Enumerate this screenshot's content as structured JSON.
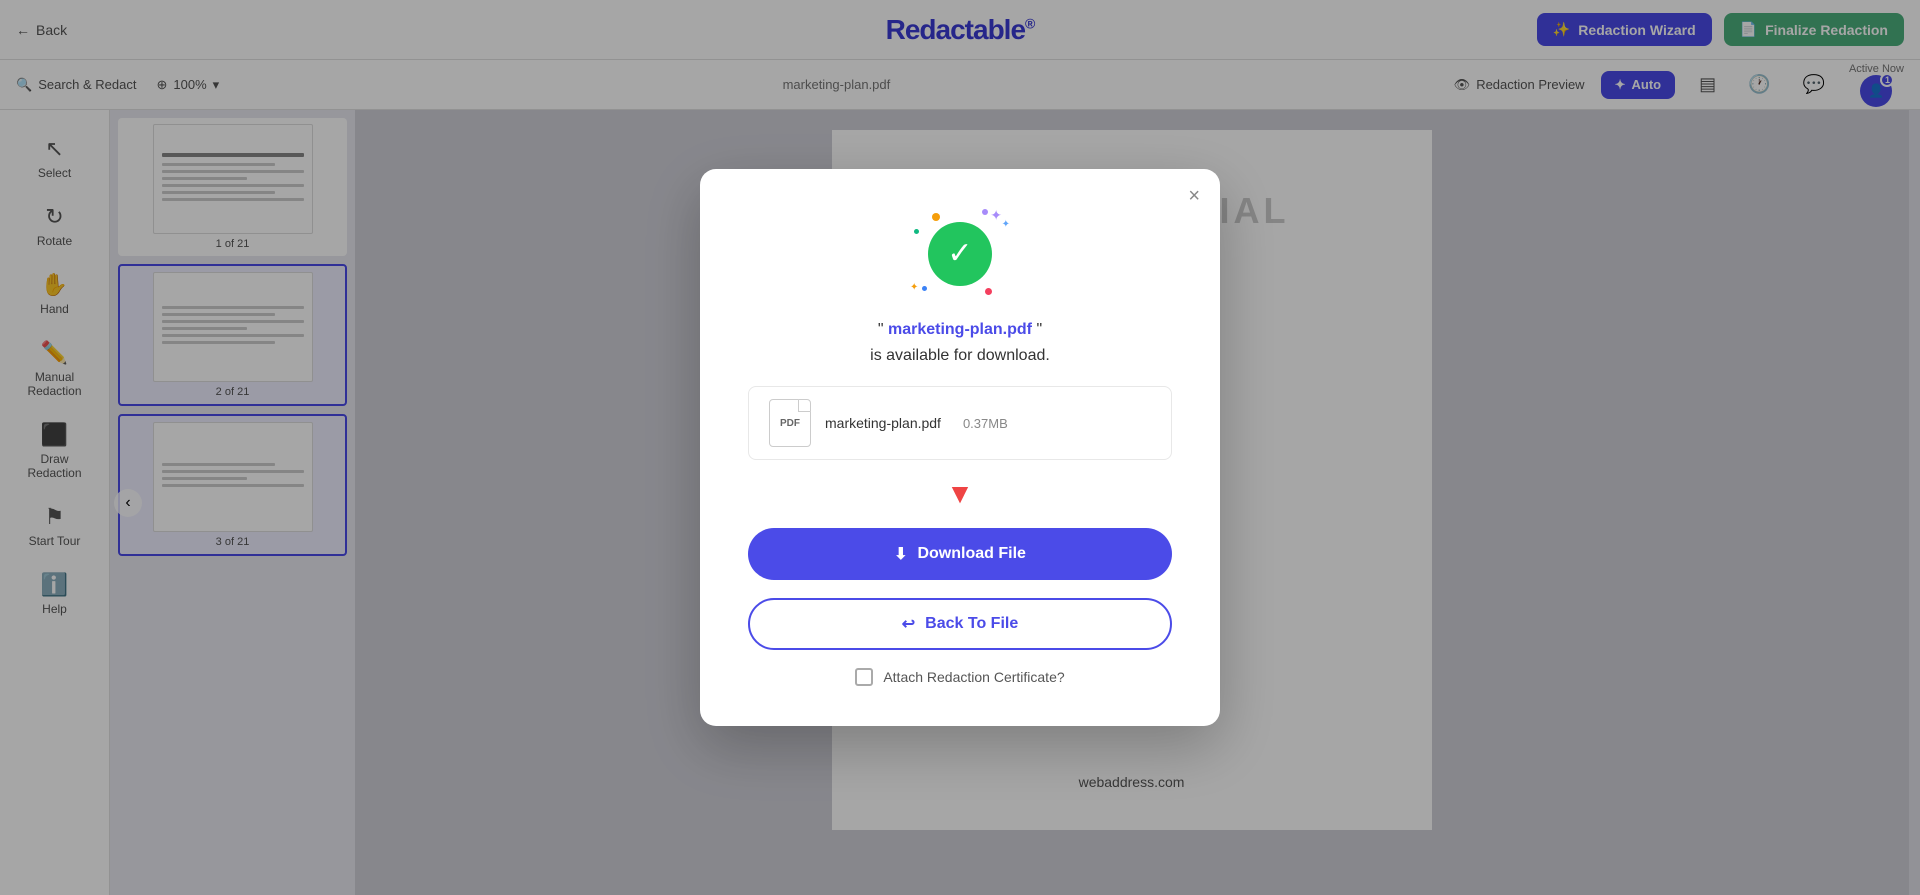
{
  "topbar": {
    "back_label": "Back",
    "logo_text": "Redactable",
    "logo_symbol": "®",
    "redaction_wizard_label": "Redaction Wizard",
    "finalize_label": "Finalize Redaction"
  },
  "secondbar": {
    "search_label": "Search & Redact",
    "zoom_level": "100%",
    "filename": "marketing-plan.pdf",
    "redaction_preview_label": "Redaction Preview",
    "auto_label": "Auto",
    "active_now_label": "Active Now",
    "user_count": "1"
  },
  "sidebar": {
    "items": [
      {
        "id": "select",
        "label": "Select",
        "icon": "↖"
      },
      {
        "id": "rotate",
        "label": "Rotate",
        "icon": "↻"
      },
      {
        "id": "hand",
        "label": "Hand",
        "icon": "✋"
      },
      {
        "id": "manual-redaction",
        "label": "Manual Redaction",
        "icon": "✏"
      },
      {
        "id": "draw-redaction",
        "label": "Draw Redaction",
        "icon": "⬛"
      },
      {
        "id": "start-tour",
        "label": "Start Tour",
        "icon": "⚑"
      },
      {
        "id": "help",
        "label": "Help",
        "icon": "ℹ"
      }
    ]
  },
  "thumbnails": [
    {
      "label": "1 of 21",
      "active": false
    },
    {
      "label": "2 of 21",
      "active": true
    },
    {
      "label": "3 of 21",
      "active": true
    }
  ],
  "document": {
    "watermark": "CONFIDENTIAL",
    "web_address": "webaddress.com"
  },
  "modal": {
    "close_label": "×",
    "success_icon": "✓",
    "message_prefix": "\"",
    "filename_link": "marketing-plan.pdf",
    "message_suffix": "\"",
    "message_body": "is available for download.",
    "file_info": {
      "name": "marketing-plan.pdf",
      "size": "0.37MB",
      "icon_label": "PDF"
    },
    "download_label": "Download File",
    "back_label": "Back To File",
    "certificate_label": "Attach Redaction Certificate?"
  }
}
